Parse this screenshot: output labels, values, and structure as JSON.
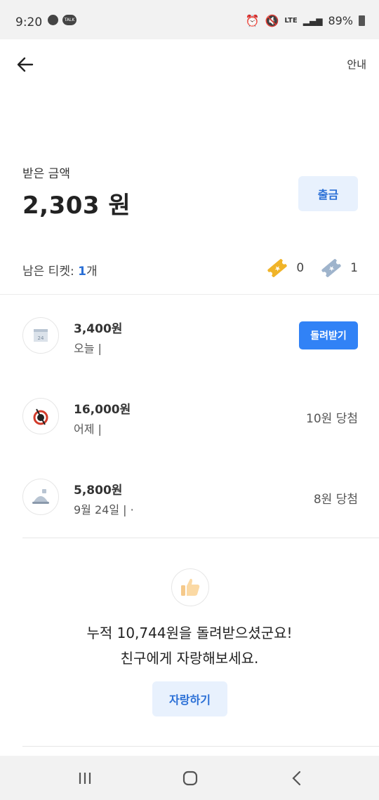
{
  "status_bar": {
    "time": "9:20",
    "network": "LTE",
    "battery": "89%"
  },
  "header": {
    "info_label": "안내"
  },
  "balance": {
    "label": "받은 금액",
    "amount": "2,303 원",
    "withdraw_label": "출금"
  },
  "tickets": {
    "label": "남은 티켓: ",
    "count": "1",
    "unit": "개",
    "gold_count": "0",
    "silver_count": "1"
  },
  "transactions": [
    {
      "amount": "3,400원",
      "date": "오늘 |",
      "action_label": "돌려받기",
      "icon": "convenience-store-icon"
    },
    {
      "amount": "16,000원",
      "date": "어제 |",
      "result": "10원 당첨",
      "icon": "restaurant-logo-icon"
    },
    {
      "amount": "5,800원",
      "date": "9월 24일 | ·",
      "result": "8원 당첨",
      "icon": "food-delivery-icon"
    }
  ],
  "summary": {
    "line1": "누적 10,744원을 돌려받으셨군요!",
    "line2": "친구에게 자랑해보세요.",
    "share_label": "자랑하기"
  },
  "colors": {
    "accent": "#3182f6",
    "accent_soft": "#e8f1fd",
    "accent_text": "#2a6fd6"
  }
}
